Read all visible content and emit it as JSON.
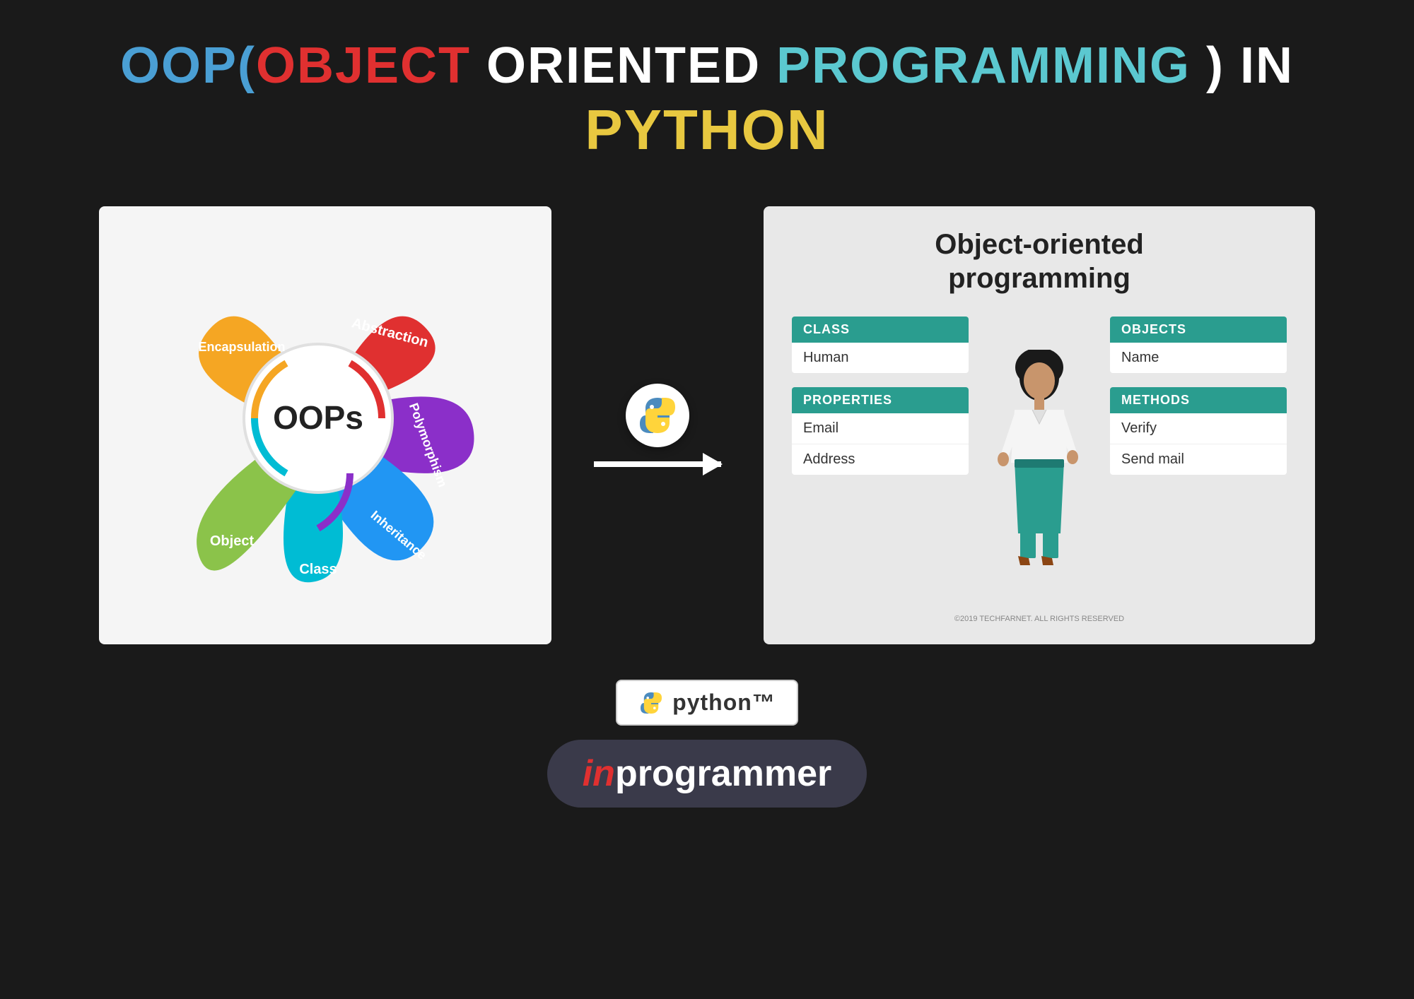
{
  "title": {
    "line1_parts": [
      {
        "text": "OOP(",
        "color": "blue"
      },
      {
        "text": "OBJECT",
        "color": "red"
      },
      {
        "text": " ORIENTED ",
        "color": "white"
      },
      {
        "text": "PROGRAMMING",
        "color": "teal"
      },
      {
        "text": " ) IN",
        "color": "white"
      }
    ],
    "line2": "PYTHON",
    "line2_color": "yellow"
  },
  "left_diagram": {
    "center_text": "OOPs",
    "petals": [
      {
        "label": "Encapsulation",
        "color": "#f5a623"
      },
      {
        "label": "Abstraction",
        "color": "#e03030"
      },
      {
        "label": "Polymorphism",
        "color": "#8b2fc9"
      },
      {
        "label": "Inheritance",
        "color": "#2196f3"
      },
      {
        "label": "Class",
        "color": "#00bcd4"
      },
      {
        "label": "Object",
        "color": "#8bc34a"
      }
    ]
  },
  "right_diagram": {
    "title": "Object-oriented\nprogramming",
    "class_box": {
      "header": "CLASS",
      "items": [
        "Human"
      ]
    },
    "objects_box": {
      "header": "OBJECTS",
      "items": [
        "Name"
      ]
    },
    "properties_box": {
      "header": "PROPERTIES",
      "items": [
        "Email",
        "Address"
      ]
    },
    "methods_box": {
      "header": "METHODS",
      "items": [
        "Verify",
        "Send mail"
      ]
    }
  },
  "python_badge": {
    "text": "python™"
  },
  "brand": {
    "in": "in",
    "programmer": "programmer"
  },
  "copyright": "©2019 TECHFARNET. ALL RIGHTS RESERVED"
}
